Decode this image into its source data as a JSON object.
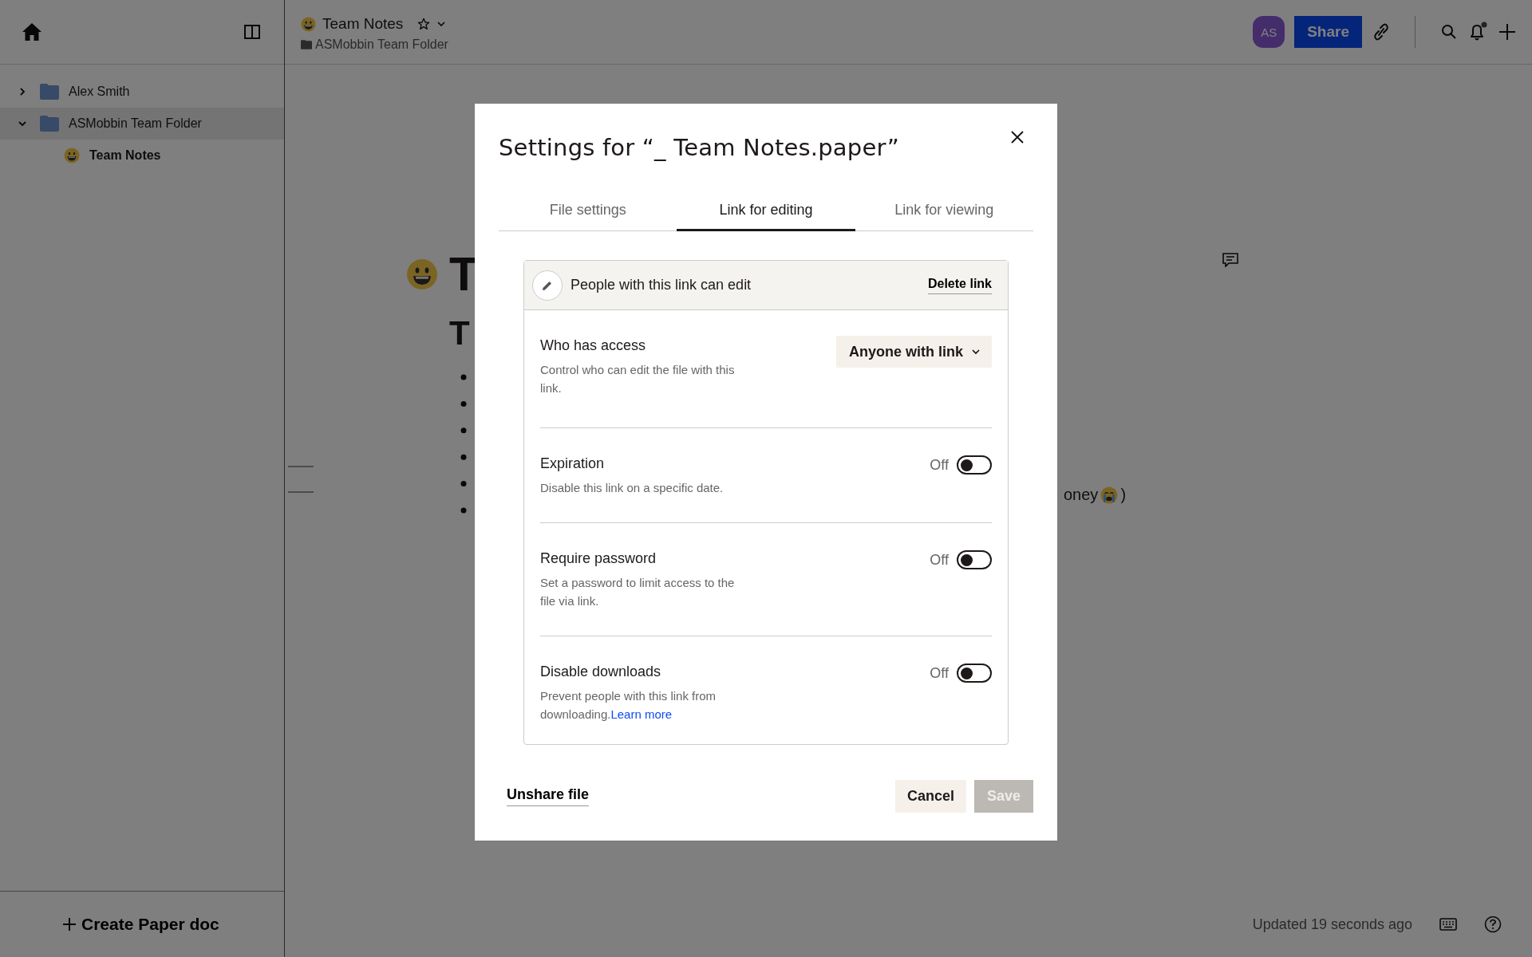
{
  "sidebar": {
    "items": [
      {
        "label": "Alex Smith",
        "expanded": false,
        "selected": false
      },
      {
        "label": "ASMobbin Team Folder",
        "expanded": true,
        "selected": true,
        "children": [
          {
            "label": "Team Notes"
          }
        ]
      }
    ],
    "create_button": "Create Paper doc"
  },
  "header": {
    "title": "Team Notes",
    "breadcrumb": "ASMobbin Team Folder",
    "avatar": "AS",
    "share_button": "Share"
  },
  "document": {
    "title_fragment": "T",
    "heading_fragment": "T",
    "text_fragment": "oney",
    "text_fragment_end": ")"
  },
  "status_bar": {
    "updated": "Updated 19 seconds ago"
  },
  "dialog": {
    "title": "Settings for “_ Team Notes.paper”",
    "tabs": [
      {
        "label": "File settings",
        "selected": false
      },
      {
        "label": "Link for editing",
        "selected": true
      },
      {
        "label": "Link for viewing",
        "selected": false
      }
    ],
    "link_card": {
      "heading": "People with this link can edit",
      "delete_link": "Delete link",
      "access": {
        "label": "Who has access",
        "description": "Control who can edit the file with this link.",
        "dropdown": "Anyone with link"
      },
      "settings": [
        {
          "label": "Expiration",
          "description": "Disable this link on a specific date.",
          "state_text": "Off",
          "on": false
        },
        {
          "label": "Require password",
          "description": "Set a password to limit access to the file via link.",
          "state_text": "Off",
          "on": false
        },
        {
          "label": "Disable downloads",
          "description": "Prevent people with this link from downloading.",
          "link": "Learn more",
          "state_text": "Off",
          "on": false
        }
      ]
    },
    "footer": {
      "unshare": "Unshare file",
      "cancel": "Cancel",
      "save": {
        "label": "Save",
        "disabled": true
      }
    }
  }
}
